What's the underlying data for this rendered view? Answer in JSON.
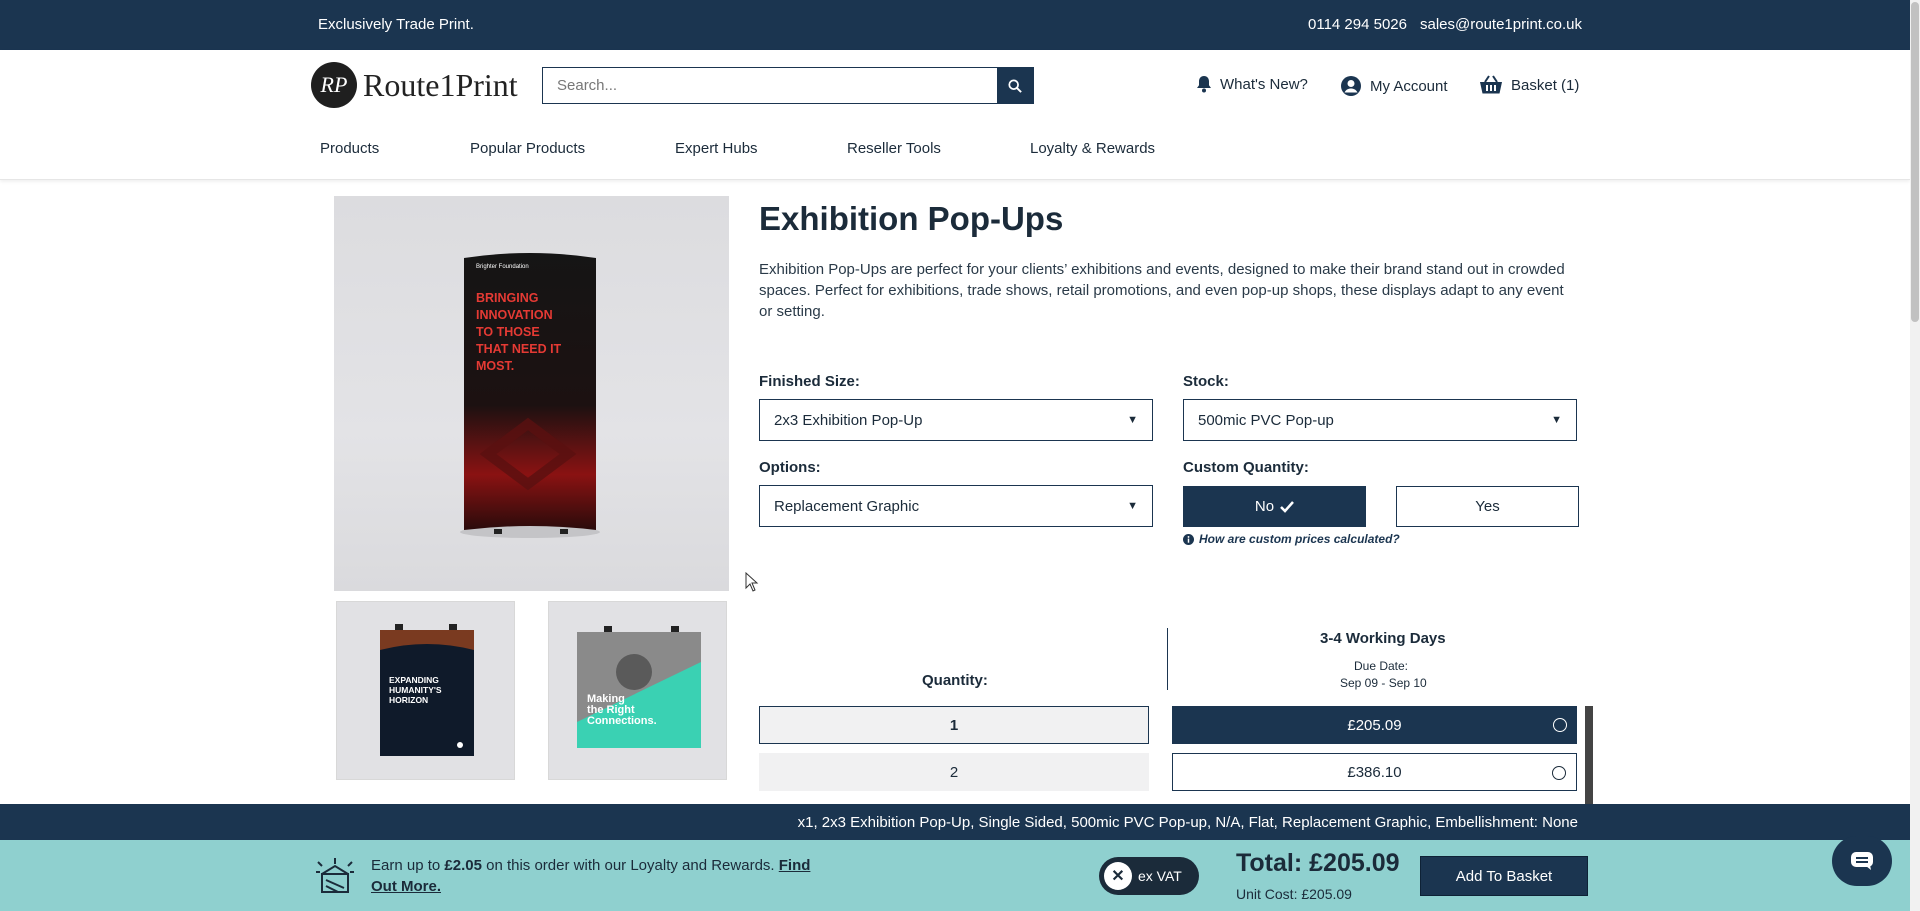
{
  "topbar": {
    "tagline": "Exclusively Trade Print.",
    "phone": "0114 294 5026",
    "email": "sales@route1print.co.uk"
  },
  "header": {
    "logo_mark": "RP",
    "logo_text": "Route1Print",
    "search_placeholder": "Search...",
    "whats_new": "What's New?",
    "my_account": "My Account",
    "basket": "Basket (1)"
  },
  "nav": [
    "Products",
    "Popular Products",
    "Expert Hubs",
    "Reseller Tools",
    "Loyalty & Rewards"
  ],
  "gallery": {
    "main_headline": [
      "BRINGING",
      "INNOVATION",
      "TO THOSE",
      "THAT NEED IT",
      "MOST."
    ],
    "main_brand": "Brighter Foundation",
    "thumb1_text": [
      "EXPANDING",
      "HUMANITY'S",
      "HORIZON"
    ],
    "thumb2_text": [
      "Making",
      "the Right",
      "Connections."
    ]
  },
  "product": {
    "title": "Exhibition Pop-Ups",
    "description": "Exhibition Pop-Ups are perfect for your clients’ exhibitions and events, designed to make their brand stand out in crowded spaces. Perfect for exhibitions, trade shows, retail promotions, and even pop-up shops, these displays adapt to any event or setting."
  },
  "form": {
    "finished_size_label": "Finished Size:",
    "finished_size_value": "2x3 Exhibition Pop-Up",
    "stock_label": "Stock:",
    "stock_value": "500mic PVC Pop-up",
    "options_label": "Options:",
    "options_value": "Replacement Graphic",
    "custom_qty_label": "Custom Quantity:",
    "no_label": "No",
    "yes_label": "Yes",
    "custom_help": "How are custom prices calculated?"
  },
  "pricing": {
    "quantity_header": "Quantity:",
    "days_header": "3-4 Working Days",
    "due_label": "Due Date:",
    "due_range": "Sep 09 - Sep 10",
    "rows": [
      {
        "qty": "1",
        "price": "£205.09"
      },
      {
        "qty": "2",
        "price": "£386.10"
      }
    ]
  },
  "summary": "x1, 2x3 Exhibition Pop-Up, Single Sided, 500mic PVC Pop-up, N/A, Flat, Replacement Graphic, Embellishment: None",
  "footer": {
    "loyalty_pre": "Earn up to ",
    "loyalty_amount": "£2.05",
    "loyalty_mid": " on this order with our Loyalty and Rewards. ",
    "loyalty_link": "Find Out More.",
    "vat_label": "ex VAT",
    "total": "Total: £205.09",
    "unit_cost": "Unit Cost: £205.09",
    "add_button": "Add To Basket"
  },
  "colors": {
    "navy": "#1b3550",
    "teal_footer": "#8fd0cf",
    "product_red": "#d9302c"
  }
}
